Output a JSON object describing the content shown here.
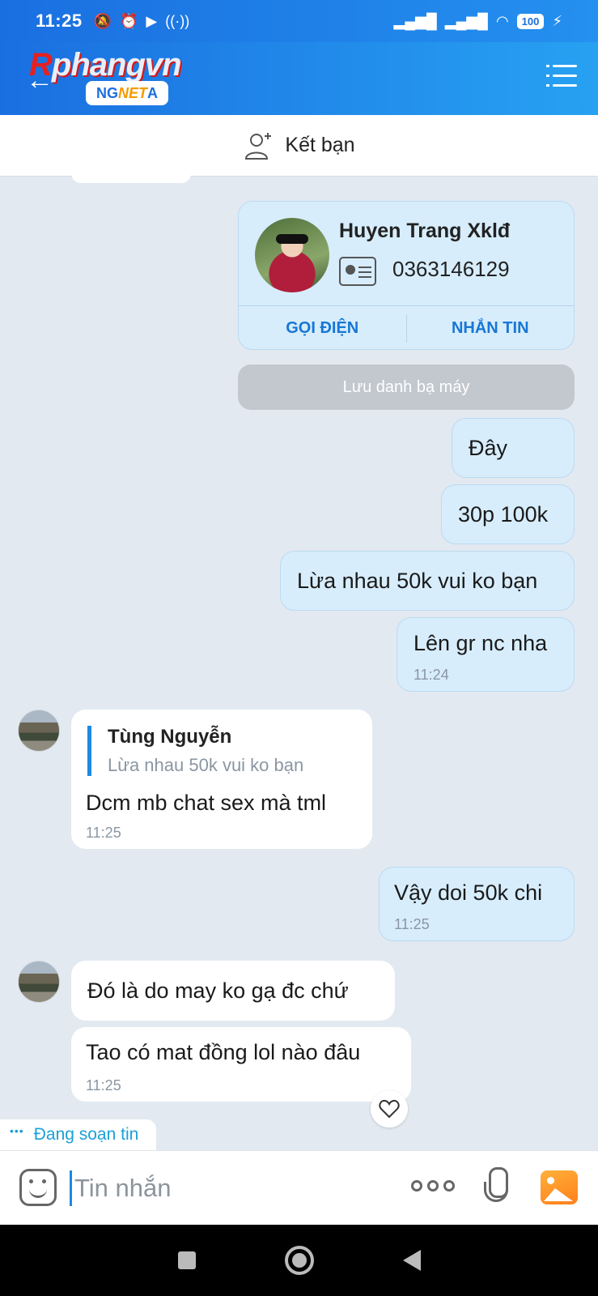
{
  "status_bar": {
    "time": "11:25",
    "battery": "100"
  },
  "header": {
    "logo_main_r": "R",
    "logo_main": "phangvn",
    "logo_badge_left": "NG",
    "logo_badge_net": "NET",
    "logo_badge_right": "A"
  },
  "friend_bar": {
    "label": "Kết bạn"
  },
  "contact_card": {
    "name": "Huyen Trang Xklđ",
    "phone": "0363146129",
    "call_label": "GỌI ĐIỆN",
    "message_label": "NHẮN TIN",
    "save_label": "Lưu danh bạ máy"
  },
  "messages": [
    {
      "direction": "out",
      "text": "Đây"
    },
    {
      "direction": "out",
      "text": "30p 100k"
    },
    {
      "direction": "out",
      "text": "Lừa nhau 50k vui ko bạn"
    },
    {
      "direction": "out",
      "text": "Lên gr nc nha",
      "time": "11:24"
    },
    {
      "direction": "in",
      "quote_name": "Tùng Nguyễn",
      "quote_text": "Lừa nhau 50k vui ko bạn",
      "text": "Dcm mb chat sex mà tml",
      "time": "11:25"
    },
    {
      "direction": "out",
      "text": "Vậy doi 50k chi",
      "time": "11:25"
    },
    {
      "direction": "in",
      "text": "Đó là do may ko gạ đc chứ"
    },
    {
      "direction": "in",
      "text": "Tao có mat đồng lol nào đâu",
      "time": "11:25"
    }
  ],
  "typing_indicator": "Đang soạn tin",
  "composer": {
    "placeholder": "Tin nhắn"
  }
}
